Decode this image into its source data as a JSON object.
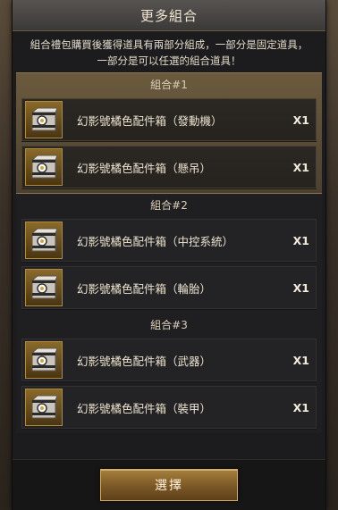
{
  "dialog": {
    "title": "更多組合",
    "description_line1": "組合禮包購買後獲得道具有兩部分組成，一部分是固定道具，",
    "description_line2": "一部分是可以任選的組合道具！"
  },
  "groups": [
    {
      "label": "組合#1",
      "items": [
        {
          "name": "幻影號橘色配件箱（發動機）",
          "qty": "X1"
        },
        {
          "name": "幻影號橘色配件箱（懸吊）",
          "qty": "X1"
        }
      ]
    },
    {
      "label": "組合#2",
      "items": [
        {
          "name": "幻影號橘色配件箱（中控系統）",
          "qty": "X1"
        },
        {
          "name": "幻影號橘色配件箱（輪胎）",
          "qty": "X1"
        }
      ]
    },
    {
      "label": "組合#3",
      "items": [
        {
          "name": "幻影號橘色配件箱（武器）",
          "qty": "X1"
        },
        {
          "name": "幻影號橘色配件箱（裝甲）",
          "qty": "X1"
        }
      ]
    }
  ],
  "footer": {
    "select_label": "選擇"
  },
  "icons": {
    "item": "crate-icon"
  },
  "colors": {
    "accent_gold": "#b08a3e",
    "highlight_bg": "#6b5a3d",
    "panel_bg": "#1c1c1e"
  }
}
